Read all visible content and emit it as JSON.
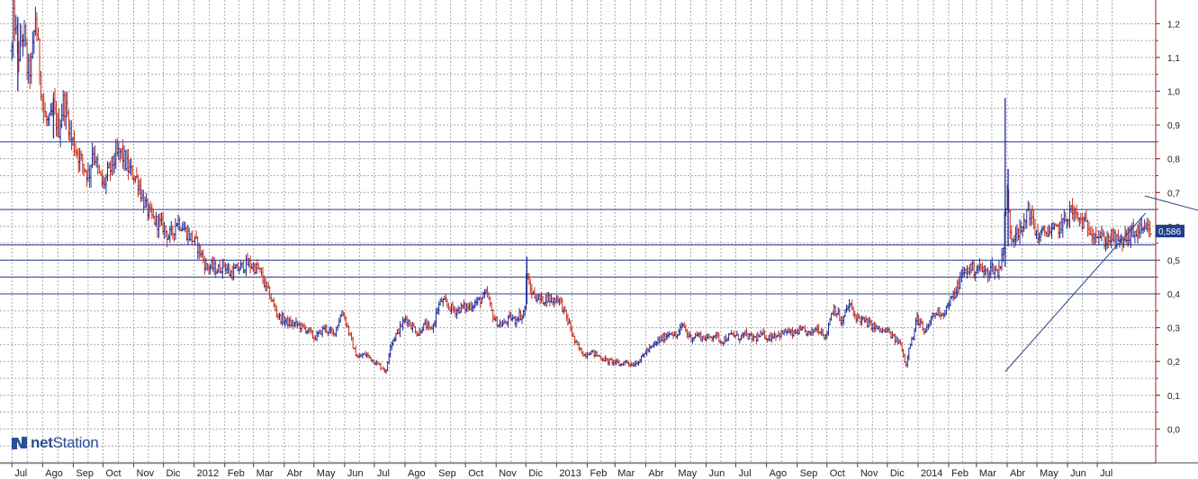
{
  "brand": {
    "name": "netStation",
    "prefix": "net",
    "suffix": "Station",
    "color": "#2a4f95"
  },
  "price_tag": {
    "value": "0,586",
    "bg": "#1f3f8a"
  },
  "colors": {
    "up": "#1d2b9c",
    "down": "#c8301c",
    "grid": "#a8a8a8",
    "hline": "#2b3f8c",
    "axis": "#9c1f1f",
    "trend": "#2b3f8c"
  },
  "chart_data": {
    "type": "bar",
    "subtype": "ohlc",
    "y_ticks": [
      "0,0",
      "0,1",
      "0,2",
      "0,3",
      "0,4",
      "0,5",
      "0,6",
      "0,7",
      "0,8",
      "0,9",
      "1,0",
      "1,1",
      "1,2"
    ],
    "y_tick_values": [
      0.0,
      0.1,
      0.2,
      0.3,
      0.4,
      0.5,
      0.6,
      0.7,
      0.8,
      0.9,
      1.0,
      1.1,
      1.2
    ],
    "ylim": [
      -0.1,
      1.27
    ],
    "grid": true,
    "x_ticks": [
      {
        "label": "Jul",
        "day": 0
      },
      {
        "label": "Ago",
        "day": 31
      },
      {
        "label": "Sep",
        "day": 62
      },
      {
        "label": "Oct",
        "day": 92
      },
      {
        "label": "Nov",
        "day": 123
      },
      {
        "label": "Dic",
        "day": 153
      },
      {
        "label": "2012",
        "day": 184
      },
      {
        "label": "Feb",
        "day": 215
      },
      {
        "label": "Mar",
        "day": 244
      },
      {
        "label": "Abr",
        "day": 275
      },
      {
        "label": "May",
        "day": 305
      },
      {
        "label": "Jun",
        "day": 336
      },
      {
        "label": "Jul",
        "day": 366
      },
      {
        "label": "Ago",
        "day": 397
      },
      {
        "label": "Sep",
        "day": 428
      },
      {
        "label": "Oct",
        "day": 458
      },
      {
        "label": "Nov",
        "day": 489
      },
      {
        "label": "Dic",
        "day": 519
      },
      {
        "label": "2013",
        "day": 550
      },
      {
        "label": "Feb",
        "day": 581
      },
      {
        "label": "Mar",
        "day": 609
      },
      {
        "label": "Abr",
        "day": 640
      },
      {
        "label": "May",
        "day": 670
      },
      {
        "label": "Jun",
        "day": 701
      },
      {
        "label": "Jul",
        "day": 731
      },
      {
        "label": "Ago",
        "day": 762
      },
      {
        "label": "Sep",
        "day": 793
      },
      {
        "label": "Oct",
        "day": 823
      },
      {
        "label": "Nov",
        "day": 854
      },
      {
        "label": "Dic",
        "day": 884
      },
      {
        "label": "2014",
        "day": 915
      },
      {
        "label": "Feb",
        "day": 946
      },
      {
        "label": "Mar",
        "day": 974
      },
      {
        "label": "Abr",
        "day": 1005
      },
      {
        "label": "May",
        "day": 1035
      },
      {
        "label": "Jun",
        "day": 1066
      },
      {
        "label": "Jul",
        "day": 1096
      }
    ],
    "xlim_days": [
      -12,
      1155
    ],
    "horizontal_levels": [
      0.85,
      0.65,
      0.545,
      0.5,
      0.45,
      0.4
    ],
    "trend_lines": [
      {
        "from": {
          "day": 1003,
          "value": 0.17
        },
        "to": {
          "day": 1145,
          "value": 0.64
        }
      },
      {
        "from": {
          "day": 1144,
          "value": 0.69
        },
        "to": {
          "day": 1258,
          "value": 0.6
        }
      }
    ],
    "last_value": 0.586,
    "price_path": [
      [
        0,
        1.12
      ],
      [
        2,
        1.24
      ],
      [
        6,
        1.1
      ],
      [
        12,
        1.18
      ],
      [
        16,
        1.05
      ],
      [
        20,
        1.08
      ],
      [
        24,
        1.23
      ],
      [
        27,
        1.1
      ],
      [
        30,
        1.0
      ],
      [
        33,
        0.92
      ],
      [
        38,
        0.9
      ],
      [
        42,
        0.95
      ],
      [
        47,
        0.88
      ],
      [
        52,
        0.97
      ],
      [
        56,
        0.93
      ],
      [
        60,
        0.86
      ],
      [
        66,
        0.82
      ],
      [
        72,
        0.78
      ],
      [
        78,
        0.75
      ],
      [
        82,
        0.84
      ],
      [
        86,
        0.77
      ],
      [
        92,
        0.72
      ],
      [
        98,
        0.76
      ],
      [
        104,
        0.8
      ],
      [
        110,
        0.82
      ],
      [
        116,
        0.78
      ],
      [
        120,
        0.76
      ],
      [
        124,
        0.75
      ],
      [
        128,
        0.73
      ],
      [
        132,
        0.68
      ],
      [
        138,
        0.64
      ],
      [
        143,
        0.62
      ],
      [
        148,
        0.61
      ],
      [
        153,
        0.6
      ],
      [
        158,
        0.57
      ],
      [
        162,
        0.58
      ],
      [
        167,
        0.62
      ],
      [
        172,
        0.6
      ],
      [
        177,
        0.58
      ],
      [
        180,
        0.57
      ],
      [
        186,
        0.55
      ],
      [
        191,
        0.52
      ],
      [
        196,
        0.48
      ],
      [
        202,
        0.48
      ],
      [
        208,
        0.47
      ],
      [
        214,
        0.49
      ],
      [
        220,
        0.46
      ],
      [
        226,
        0.47
      ],
      [
        232,
        0.48
      ],
      [
        238,
        0.49
      ],
      [
        244,
        0.48
      ],
      [
        250,
        0.47
      ],
      [
        255,
        0.43
      ],
      [
        260,
        0.4
      ],
      [
        265,
        0.36
      ],
      [
        270,
        0.33
      ],
      [
        276,
        0.32
      ],
      [
        282,
        0.31
      ],
      [
        288,
        0.31
      ],
      [
        294,
        0.3
      ],
      [
        300,
        0.29
      ],
      [
        305,
        0.27
      ],
      [
        310,
        0.28
      ],
      [
        315,
        0.3
      ],
      [
        320,
        0.29
      ],
      [
        325,
        0.28
      ],
      [
        330,
        0.32
      ],
      [
        334,
        0.35
      ],
      [
        338,
        0.31
      ],
      [
        343,
        0.26
      ],
      [
        346,
        0.23
      ],
      [
        350,
        0.21
      ],
      [
        354,
        0.22
      ],
      [
        358,
        0.22
      ],
      [
        362,
        0.21
      ],
      [
        366,
        0.2
      ],
      [
        370,
        0.19
      ],
      [
        375,
        0.18
      ],
      [
        378,
        0.17
      ],
      [
        382,
        0.25
      ],
      [
        386,
        0.27
      ],
      [
        390,
        0.29
      ],
      [
        394,
        0.31
      ],
      [
        398,
        0.33
      ],
      [
        402,
        0.31
      ],
      [
        406,
        0.3
      ],
      [
        410,
        0.28
      ],
      [
        414,
        0.3
      ],
      [
        418,
        0.31
      ],
      [
        422,
        0.29
      ],
      [
        426,
        0.31
      ],
      [
        430,
        0.36
      ],
      [
        434,
        0.38
      ],
      [
        438,
        0.37
      ],
      [
        442,
        0.36
      ],
      [
        448,
        0.35
      ],
      [
        454,
        0.36
      ],
      [
        460,
        0.36
      ],
      [
        466,
        0.37
      ],
      [
        472,
        0.38
      ],
      [
        476,
        0.39
      ],
      [
        480,
        0.4
      ],
      [
        484,
        0.35
      ],
      [
        488,
        0.32
      ],
      [
        492,
        0.31
      ],
      [
        496,
        0.31
      ],
      [
        500,
        0.32
      ],
      [
        504,
        0.33
      ],
      [
        508,
        0.32
      ],
      [
        512,
        0.34
      ],
      [
        515,
        0.33
      ],
      [
        518,
        0.36
      ],
      [
        520,
        0.48
      ],
      [
        522,
        0.42
      ],
      [
        526,
        0.4
      ],
      [
        530,
        0.39
      ],
      [
        535,
        0.38
      ],
      [
        540,
        0.39
      ],
      [
        546,
        0.38
      ],
      [
        552,
        0.39
      ],
      [
        556,
        0.36
      ],
      [
        560,
        0.33
      ],
      [
        564,
        0.3
      ],
      [
        568,
        0.26
      ],
      [
        572,
        0.24
      ],
      [
        578,
        0.22
      ],
      [
        584,
        0.23
      ],
      [
        590,
        0.22
      ],
      [
        596,
        0.21
      ],
      [
        602,
        0.2
      ],
      [
        608,
        0.2
      ],
      [
        614,
        0.19
      ],
      [
        620,
        0.2
      ],
      [
        626,
        0.19
      ],
      [
        632,
        0.2
      ],
      [
        636,
        0.21
      ],
      [
        640,
        0.23
      ],
      [
        646,
        0.24
      ],
      [
        652,
        0.26
      ],
      [
        658,
        0.27
      ],
      [
        662,
        0.28
      ],
      [
        666,
        0.29
      ],
      [
        670,
        0.27
      ],
      [
        674,
        0.29
      ],
      [
        678,
        0.31
      ],
      [
        682,
        0.28
      ],
      [
        686,
        0.27
      ],
      [
        692,
        0.28
      ],
      [
        698,
        0.27
      ],
      [
        704,
        0.27
      ],
      [
        710,
        0.28
      ],
      [
        716,
        0.26
      ],
      [
        722,
        0.27
      ],
      [
        728,
        0.28
      ],
      [
        734,
        0.27
      ],
      [
        740,
        0.28
      ],
      [
        746,
        0.27
      ],
      [
        752,
        0.27
      ],
      [
        758,
        0.28
      ],
      [
        764,
        0.27
      ],
      [
        770,
        0.28
      ],
      [
        776,
        0.28
      ],
      [
        782,
        0.29
      ],
      [
        788,
        0.28
      ],
      [
        794,
        0.29
      ],
      [
        800,
        0.29
      ],
      [
        806,
        0.28
      ],
      [
        812,
        0.3
      ],
      [
        818,
        0.29
      ],
      [
        822,
        0.27
      ],
      [
        826,
        0.33
      ],
      [
        830,
        0.36
      ],
      [
        834,
        0.34
      ],
      [
        838,
        0.31
      ],
      [
        842,
        0.35
      ],
      [
        846,
        0.37
      ],
      [
        850,
        0.34
      ],
      [
        854,
        0.33
      ],
      [
        860,
        0.32
      ],
      [
        866,
        0.31
      ],
      [
        872,
        0.3
      ],
      [
        878,
        0.29
      ],
      [
        884,
        0.29
      ],
      [
        890,
        0.27
      ],
      [
        894,
        0.26
      ],
      [
        898,
        0.25
      ],
      [
        900,
        0.22
      ],
      [
        903,
        0.19
      ],
      [
        906,
        0.25
      ],
      [
        910,
        0.27
      ],
      [
        914,
        0.33
      ],
      [
        918,
        0.31
      ],
      [
        921,
        0.28
      ],
      [
        925,
        0.3
      ],
      [
        928,
        0.33
      ],
      [
        932,
        0.34
      ],
      [
        936,
        0.35
      ],
      [
        940,
        0.34
      ],
      [
        944,
        0.36
      ],
      [
        948,
        0.38
      ],
      [
        952,
        0.4
      ],
      [
        956,
        0.43
      ],
      [
        960,
        0.46
      ],
      [
        964,
        0.47
      ],
      [
        968,
        0.48
      ],
      [
        972,
        0.47
      ],
      [
        976,
        0.48
      ],
      [
        980,
        0.47
      ],
      [
        984,
        0.46
      ],
      [
        990,
        0.48
      ],
      [
        996,
        0.46
      ],
      [
        1001,
        0.54
      ],
      [
        1003,
        0.65
      ],
      [
        1005,
        0.69
      ],
      [
        1008,
        0.59
      ],
      [
        1011,
        0.56
      ],
      [
        1014,
        0.6
      ],
      [
        1018,
        0.58
      ],
      [
        1022,
        0.6
      ],
      [
        1026,
        0.66
      ],
      [
        1030,
        0.62
      ],
      [
        1034,
        0.58
      ],
      [
        1038,
        0.57
      ],
      [
        1042,
        0.58
      ],
      [
        1046,
        0.59
      ],
      [
        1050,
        0.58
      ],
      [
        1054,
        0.59
      ],
      [
        1058,
        0.6
      ],
      [
        1062,
        0.61
      ],
      [
        1066,
        0.63
      ],
      [
        1070,
        0.65
      ],
      [
        1074,
        0.63
      ],
      [
        1078,
        0.62
      ],
      [
        1082,
        0.61
      ],
      [
        1086,
        0.6
      ],
      [
        1090,
        0.59
      ],
      [
        1094,
        0.58
      ],
      [
        1098,
        0.57
      ],
      [
        1102,
        0.56
      ],
      [
        1106,
        0.56
      ],
      [
        1110,
        0.57
      ],
      [
        1114,
        0.56
      ],
      [
        1118,
        0.55
      ],
      [
        1122,
        0.56
      ],
      [
        1126,
        0.57
      ],
      [
        1130,
        0.58
      ],
      [
        1134,
        0.58
      ],
      [
        1138,
        0.59
      ],
      [
        1142,
        0.58
      ],
      [
        1146,
        0.59
      ],
      [
        1150,
        0.586
      ]
    ],
    "spikes": [
      {
        "day": 6,
        "high": 1.22,
        "low": 1.0
      },
      {
        "day": 42,
        "high": 0.98,
        "low": 0.86
      },
      {
        "day": 520,
        "high": 0.51,
        "low": 0.37
      },
      {
        "day": 1003,
        "high": 0.98,
        "low": 0.48
      },
      {
        "day": 1006,
        "high": 0.77,
        "low": 0.54
      }
    ]
  }
}
